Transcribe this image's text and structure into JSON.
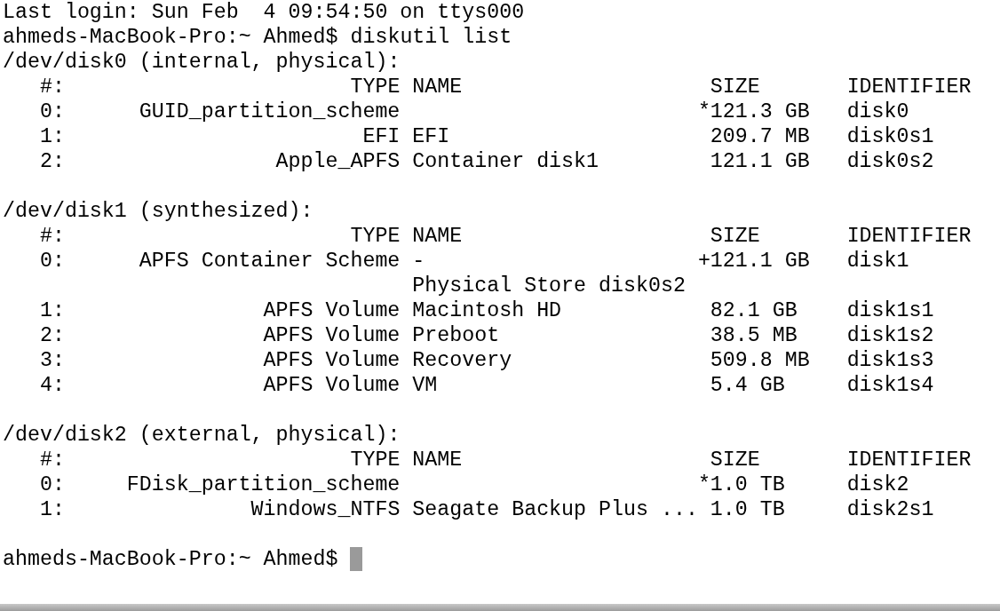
{
  "login_line": "Last login: Sun Feb  4 09:54:50 on ttys000",
  "command": {
    "prompt": "ahmeds-MacBook-Pro:~ Ahmed$",
    "text": "diskutil list"
  },
  "disks": [
    {
      "header": "/dev/disk0 (internal, physical):",
      "columns": [
        "#:",
        "TYPE",
        "NAME",
        "SIZE",
        "IDENTIFIER"
      ],
      "rows": [
        {
          "index": "0:",
          "type": "GUID_partition_scheme",
          "mark": "*",
          "size": "121.3 GB",
          "identifier": "disk0"
        },
        {
          "index": "1:",
          "type": "EFI",
          "name": "EFI",
          "size": "209.7 MB",
          "identifier": "disk0s1"
        },
        {
          "index": "2:",
          "type": "Apple_APFS",
          "name": "Container disk1",
          "size": "121.1 GB",
          "identifier": "disk0s2"
        }
      ]
    },
    {
      "header": "/dev/disk1 (synthesized):",
      "columns": [
        "#:",
        "TYPE",
        "NAME",
        "SIZE",
        "IDENTIFIER"
      ],
      "rows": [
        {
          "index": "0:",
          "type": "APFS Container Scheme",
          "name": "-",
          "mark": "+",
          "size": "121.1 GB",
          "identifier": "disk1",
          "note": "Physical Store disk0s2"
        },
        {
          "index": "1:",
          "type": "APFS Volume",
          "name": "Macintosh HD",
          "size": "82.1 GB",
          "identifier": "disk1s1"
        },
        {
          "index": "2:",
          "type": "APFS Volume",
          "name": "Preboot",
          "size": "38.5 MB",
          "identifier": "disk1s2"
        },
        {
          "index": "3:",
          "type": "APFS Volume",
          "name": "Recovery",
          "size": "509.8 MB",
          "identifier": "disk1s3"
        },
        {
          "index": "4:",
          "type": "APFS Volume",
          "name": "VM",
          "size": "5.4 GB",
          "identifier": "disk1s4"
        }
      ]
    },
    {
      "header": "/dev/disk2 (external, physical):",
      "columns": [
        "#:",
        "TYPE",
        "NAME",
        "SIZE",
        "IDENTIFIER"
      ],
      "rows": [
        {
          "index": "0:",
          "type": "FDisk_partition_scheme",
          "mark": "*",
          "size": "1.0 TB",
          "identifier": "disk2"
        },
        {
          "index": "1:",
          "type": "Windows_NTFS",
          "name": "Seagate Backup Plus ...",
          "size": "1.0 TB",
          "identifier": "disk2s1"
        }
      ]
    }
  ],
  "final_prompt": "ahmeds-MacBook-Pro:~ Ahmed$"
}
